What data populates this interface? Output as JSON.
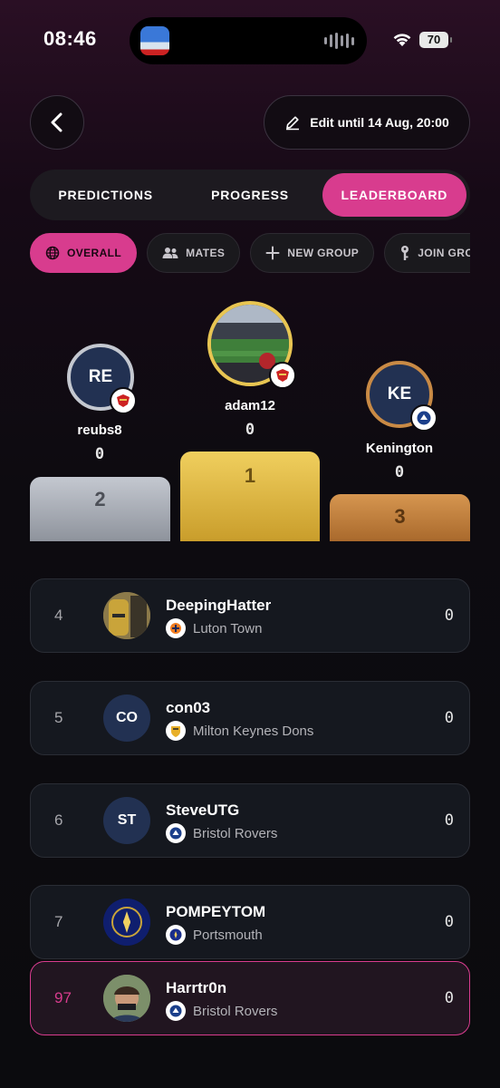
{
  "status_bar": {
    "time": "08:46",
    "battery": "70"
  },
  "header": {
    "edit_label": "Edit until 14 Aug, 20:00"
  },
  "tabs": [
    {
      "label": "PREDICTIONS",
      "active": false
    },
    {
      "label": "PROGRESS",
      "active": false
    },
    {
      "label": "LEADERBOARD",
      "active": true
    }
  ],
  "chips": [
    {
      "label": "OVERALL",
      "icon": "globe-icon",
      "active": true
    },
    {
      "label": "MATES",
      "icon": "people-icon",
      "active": false
    },
    {
      "label": "NEW GROUP",
      "icon": "plus-icon",
      "active": false
    },
    {
      "label": "JOIN GROUP",
      "icon": "key-icon",
      "active": false
    }
  ],
  "podium": {
    "first": {
      "name": "adam12",
      "score": "0",
      "place": "1",
      "avatar": "stadium-photo",
      "team_icon": "doncaster-crest-icon"
    },
    "second": {
      "name": "reubs8",
      "score": "0",
      "place": "2",
      "initials": "RE",
      "team_icon": "doncaster-crest-icon"
    },
    "third": {
      "name": "Kenington",
      "score": "0",
      "place": "3",
      "initials": "KE",
      "team_icon": "bristol-rovers-crest-icon"
    }
  },
  "rows": [
    {
      "rank": "4",
      "name": "DeepingHatter",
      "team": "Luton Town",
      "score": "0",
      "avatar": "photo"
    },
    {
      "rank": "5",
      "name": "con03",
      "team": "Milton Keynes Dons",
      "score": "0",
      "initials": "CO"
    },
    {
      "rank": "6",
      "name": "SteveUTG",
      "team": "Bristol Rovers",
      "score": "0",
      "initials": "ST"
    },
    {
      "rank": "7",
      "name": "POMPEYTOM",
      "team": "Portsmouth",
      "score": "0",
      "avatar": "crest"
    },
    {
      "rank": "97",
      "name": "Harrtr0n",
      "team": "Bristol Rovers",
      "score": "0",
      "avatar": "photo",
      "is_current_user": true
    }
  ],
  "colors": {
    "accent": "#d83c8e",
    "gold": "#e8c552",
    "silver": "#c4c8d0",
    "bronze": "#c98a45"
  }
}
